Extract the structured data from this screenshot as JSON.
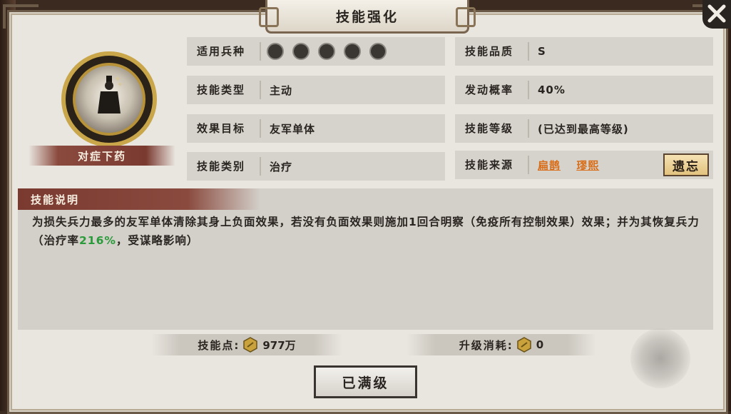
{
  "title": "技能强化",
  "skill": {
    "name": "对症下药"
  },
  "info": {
    "troop_type_label": "适用兵种",
    "troop_icons": [
      "cavalry-icon",
      "shield-icon",
      "bow-icon",
      "spear-icon",
      "siege-icon"
    ],
    "skill_type_label": "技能类型",
    "skill_type_value": "主动",
    "target_label": "效果目标",
    "target_value": "友军单体",
    "category_label": "技能类别",
    "category_value": "治疗",
    "quality_label": "技能品质",
    "quality_value": "S",
    "chance_label": "发动概率",
    "chance_value": "40%",
    "level_label": "技能等级",
    "level_value": "(已达到最高等级)",
    "source_label": "技能来源",
    "sources": [
      "扁鹊",
      "璆熙"
    ],
    "forget_label": "遗忘"
  },
  "description": {
    "header": "技能说明",
    "text_before": "为损失兵力最多的友军单体清除其身上负面效果，若没有负面效果则施加1回合明察（免疫所有控制效果）效果；并为其恢复兵力（治疗率",
    "highlight": "216%",
    "text_after": "，受谋略影响）"
  },
  "bottom": {
    "points_label": "技能点:",
    "points_value": "977万",
    "cost_label": "升级消耗:",
    "cost_value": "0",
    "maxed_label": "已满级"
  },
  "colors": {
    "highlight": "#2a9a3a",
    "source_link": "#d86e1a",
    "banner": "#7a3a30"
  }
}
